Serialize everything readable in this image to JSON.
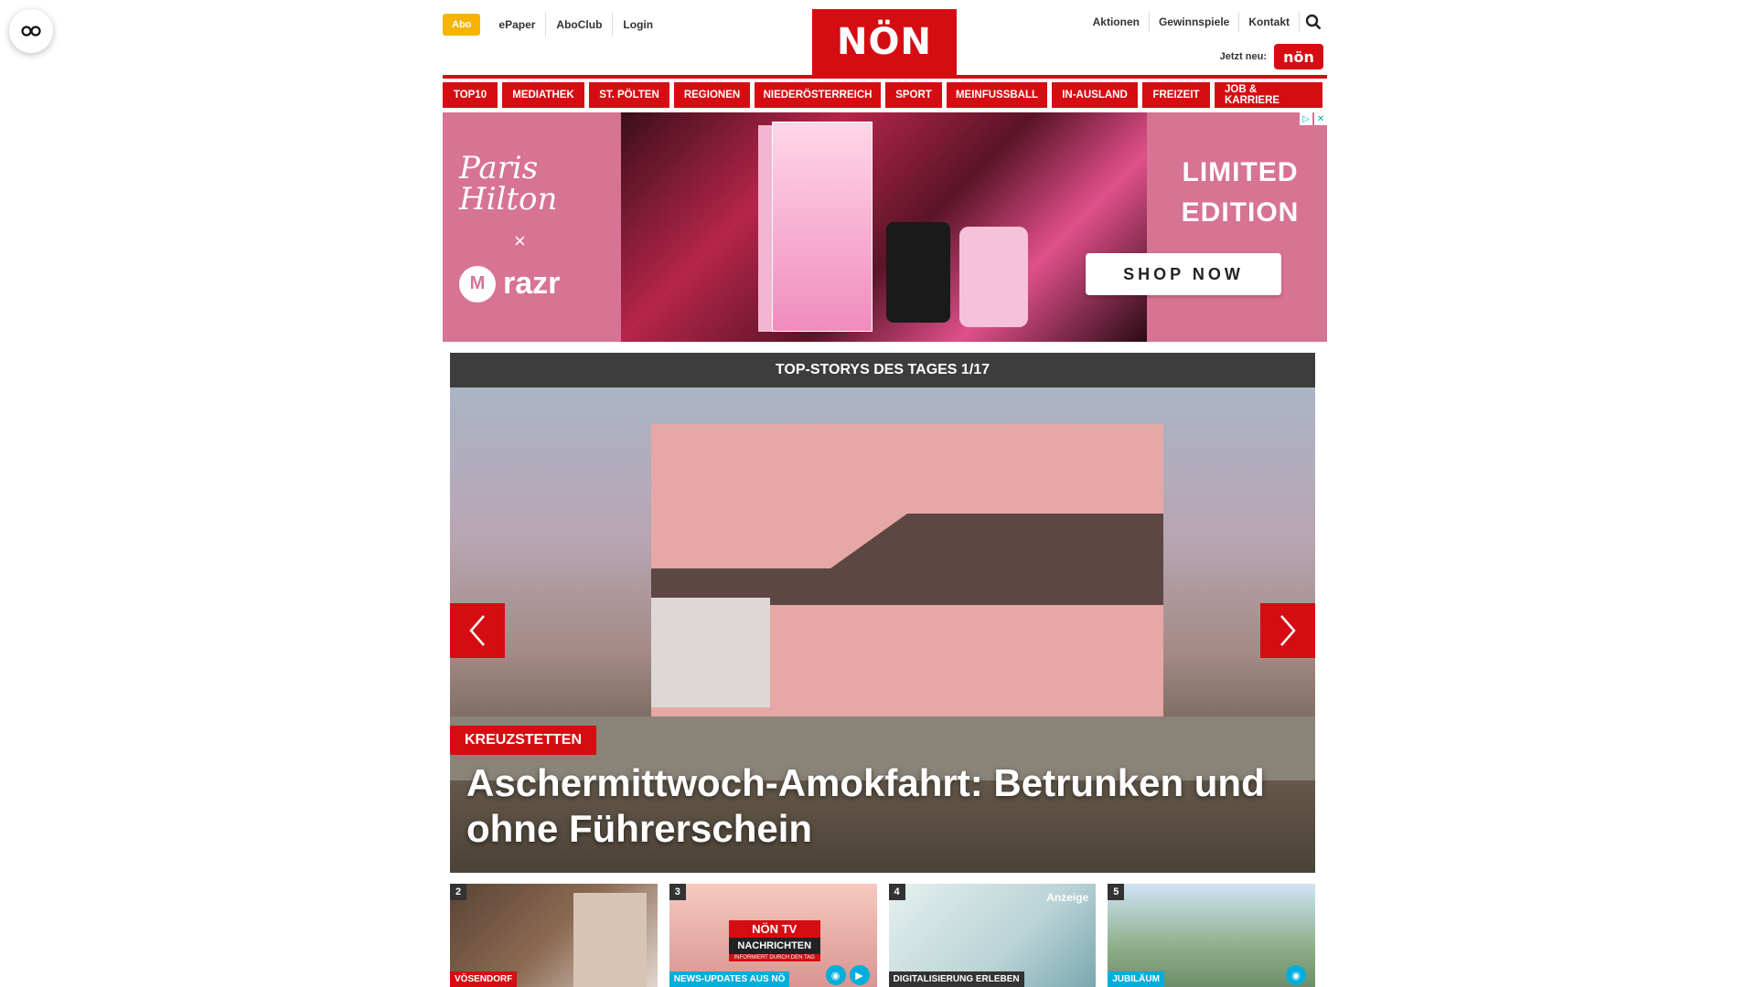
{
  "header": {
    "abo_label": "Abo",
    "links_left": [
      "ePaper",
      "AboClub",
      "Login"
    ],
    "logo_text": "NÖN",
    "links_right": [
      "Aktionen",
      "Gewinnspiele",
      "Kontakt"
    ],
    "jetzt_label": "Jetzt neu:",
    "mini_logo_text": "nön"
  },
  "nav": {
    "items": [
      "TOP10",
      "MEDIATHEK",
      "ST. PÖLTEN",
      "REGIONEN",
      "NIEDERÖSTERREICH",
      "SPORT",
      "MEINFUSSBALL",
      "IN-AUSLAND",
      "FREIZEIT",
      "JOB & KARRIERE"
    ]
  },
  "ad": {
    "brand": "Paris Hilton",
    "x": "×",
    "product": "razr",
    "headline_line1": "LIMITED",
    "headline_line2": "EDITION",
    "cta": "SHOP NOW"
  },
  "stories": {
    "heading": "TOP-STORYS DES TAGES 1/17",
    "hero": {
      "kicker": "KREUZSTETTEN",
      "headline": "Aschermittwoch-Amokfahrt: Betrunken und ohne Führerschein"
    },
    "thumbs": [
      {
        "num": "2",
        "tag": "VÖSENDORF"
      },
      {
        "num": "3",
        "tag": "NEWS-UPDATES AUS NÖ",
        "non": "NÖN",
        "tv": "TV",
        "nachrichten": "NACHRICHTEN",
        "sub": "INFORMIERT DURCH DEN TAG"
      },
      {
        "num": "4",
        "tag": "DIGITALISIERUNG ERLEBEN",
        "anzeige": "Anzeige"
      },
      {
        "num": "5",
        "tag": "JUBILÄUM"
      }
    ]
  },
  "colors": {
    "brand_red": "#d50d12",
    "abo_yellow": "#f6b400",
    "dark_bar": "#3d3d3d",
    "info_blue": "#00aedb"
  }
}
